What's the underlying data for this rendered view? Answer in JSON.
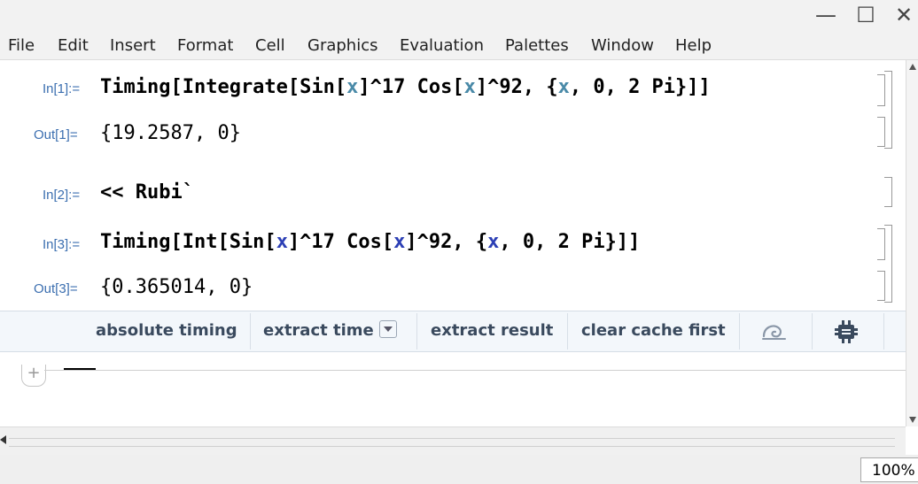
{
  "window": {
    "controls": {
      "minimize": "—",
      "maximize": "☐",
      "close": "✕"
    }
  },
  "menu": [
    "File",
    "Edit",
    "Insert",
    "Format",
    "Cell",
    "Graphics",
    "Evaluation",
    "Palettes",
    "Window",
    "Help"
  ],
  "cells": {
    "in1": {
      "label": "In[1]:=",
      "parts": [
        "Timing[Integrate[Sin[",
        "x",
        "]^17 Cos[",
        "x",
        "]^92, {",
        "x",
        ", 0, 2 Pi}]]"
      ]
    },
    "out1": {
      "label": "Out[1]=",
      "text": "{19.2587, 0}"
    },
    "in2": {
      "label": "In[2]:=",
      "text": "<< Rubi`"
    },
    "in3": {
      "label": "In[3]:=",
      "parts": [
        "Timing[Int[Sin[",
        "x",
        "]^17 Cos[",
        "x",
        "]^92, {",
        "x",
        ", 0, 2 Pi}]]"
      ]
    },
    "out3": {
      "label": "Out[3]=",
      "text": "{0.365014, 0}"
    }
  },
  "toolbar": {
    "absolute_timing": "absolute timing",
    "extract_time": "extract time",
    "extract_result": "extract result",
    "clear_cache": "clear cache first"
  },
  "insert": {
    "plus": "+"
  },
  "status": {
    "zoom": "100%"
  },
  "colors": {
    "label": "#3c6fb0",
    "variable_in1": "#4a8aa8",
    "variable_in3": "#2c3fb5",
    "toolbar_bg": "#f3f7fb"
  }
}
